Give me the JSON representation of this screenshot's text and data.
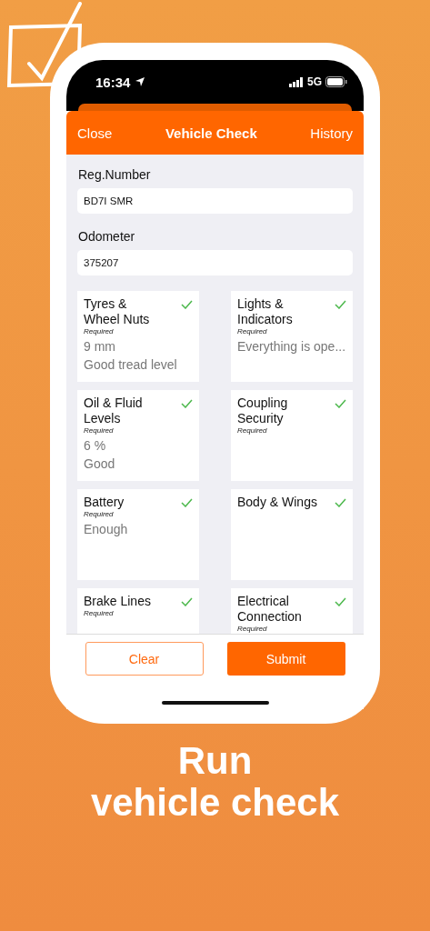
{
  "status_bar": {
    "time": "16:34",
    "network": "5G"
  },
  "nav": {
    "left": "Close",
    "title": "Vehicle Check",
    "right": "History"
  },
  "fields": [
    {
      "label": "Reg.Number",
      "value": "BD7I SMR"
    },
    {
      "label": "Odometer",
      "value": "375207"
    }
  ],
  "checks": [
    {
      "title": "Tyres & Wheel Nuts",
      "required": "Required",
      "checked": true,
      "values": [
        "9 mm",
        "Good tread level"
      ]
    },
    {
      "title": "Lights & Indicators",
      "required": "Required",
      "checked": true,
      "values": [
        "Everything is ope..."
      ]
    },
    {
      "title": "Oil & Fluid Levels",
      "required": "Required",
      "checked": true,
      "values": [
        "6 %",
        "Good"
      ]
    },
    {
      "title": "Coupling Security",
      "required": "Required",
      "checked": true
    },
    {
      "title": "Battery",
      "required": "Required",
      "checked": true,
      "values": [
        "Enough"
      ]
    },
    {
      "title": "Body & Wings",
      "checked": true
    },
    {
      "title": "Brake Lines",
      "required": "Required",
      "checked": true
    },
    {
      "title": "Electrical Connection",
      "required": "Required",
      "checked": true
    }
  ],
  "buttons": [
    {
      "label": "Clear",
      "kind": "outline"
    },
    {
      "label": "Submit",
      "kind": "filled"
    }
  ],
  "headline": [
    "Run",
    "vehicle check"
  ]
}
